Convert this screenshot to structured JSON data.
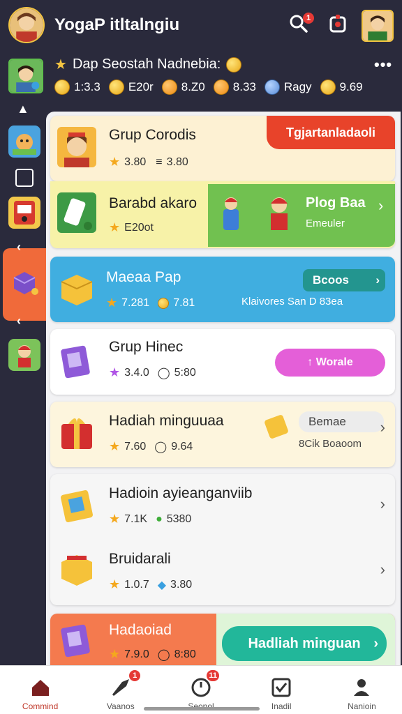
{
  "header": {
    "title": "YogaP itltalngiu",
    "search_badge": "1",
    "colors": {
      "bg": "#2a2a3c",
      "accent": "#f4c542",
      "badge": "#e53935"
    },
    "icons": [
      "app-avatar",
      "search-icon",
      "notification-icon",
      "profile-avatar"
    ]
  },
  "user": {
    "line": "Dap Seostah Nadnebia:",
    "more": "•••",
    "stats": [
      {
        "icon": "coin-icon",
        "value": "1:3.3"
      },
      {
        "icon": "coin-icon",
        "value": "E20r"
      },
      {
        "icon": "coin-icon",
        "value": "8.Z0"
      },
      {
        "icon": "coin-icon",
        "value": "8.33"
      },
      {
        "icon": "gem-icon",
        "value": "Ragy"
      },
      {
        "icon": "coin-icon",
        "value": "9.69"
      }
    ]
  },
  "sidebar": {
    "items": [
      "game-icon",
      "page-icon",
      "machine-icon",
      "box-icon",
      "character-icon"
    ],
    "arrows": [
      "‹",
      "‹",
      "‹"
    ]
  },
  "cards": [
    {
      "title": "Grup Corodis",
      "meta1": "3.80",
      "meta2": "3.80",
      "button": "Tgjartanladaoli",
      "button_color": "#e8432a",
      "bg": "#fdf1d3"
    },
    {
      "title": "Barabd akaro",
      "meta1": "E20ot",
      "promo_title": "Plog Baa",
      "promo_sub": "Emeuler",
      "promo_color": "#71c150",
      "bg": "#f7f2a8"
    },
    {
      "title": "Maeaa Pap",
      "meta1": "7.281",
      "meta2": "7.81",
      "button": "Bcoos",
      "sub": "Klaivores San D 83ea",
      "bg": "#40aee0"
    },
    {
      "title": "Grup Hinec",
      "meta1": "3.4.0",
      "meta2": "5:80",
      "button": "↑ Worale",
      "button_color": "#e45fd8",
      "bg": "#ffffff"
    },
    {
      "title": "Hadiah minguuaa",
      "meta1": "7.60",
      "meta2": "9.64",
      "side_label": "Bemae",
      "side_sub": "8Cik Boaoom",
      "bg": "#fdf5dd"
    },
    {
      "title": "Hadioin ayieanganviib",
      "meta1": "7.1K",
      "meta2": "5380",
      "bg": "#f6f6f6"
    },
    {
      "title": "Bruidarali",
      "meta1": "1.0.7",
      "meta2": "3.80",
      "bg": "#f6f6f6"
    },
    {
      "title": "Hadaoiad",
      "meta1": "7.9.0",
      "meta2": "8:80",
      "button": "Hadliah minguan",
      "button_color": "#22b79a",
      "bg": "#f47a4e"
    }
  ],
  "nav": [
    {
      "label": "Commind",
      "icon": "home-icon",
      "badge": ""
    },
    {
      "label": "Vaanos",
      "icon": "rocket-icon",
      "badge": "1"
    },
    {
      "label": "Seonol",
      "icon": "clock-icon",
      "badge": "11"
    },
    {
      "label": "Inadil",
      "icon": "check-box-icon",
      "badge": ""
    },
    {
      "label": "Nanioin",
      "icon": "person-icon",
      "badge": ""
    }
  ]
}
